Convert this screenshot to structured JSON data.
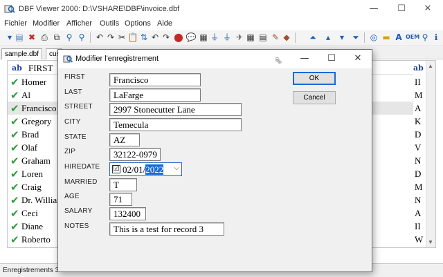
{
  "window": {
    "title": "DBF Viewer 2000: D:\\VSHARE\\DBF\\invoice.dbf",
    "minimize_icon": "minimize-icon",
    "maximize_icon": "maximize-icon",
    "close_icon": "close-icon"
  },
  "menu": [
    "Fichier",
    "Modifier",
    "Afficher",
    "Outils",
    "Options",
    "Aide"
  ],
  "tabs": [
    "sample.dbf",
    "cus"
  ],
  "grid": {
    "header_type": "ab",
    "header_label": "FIRST",
    "right_header_type": "ab",
    "rows": [
      {
        "name": "Homer",
        "right": "II",
        "selected": false
      },
      {
        "name": "Al",
        "right": "M",
        "selected": false
      },
      {
        "name": "Francisco",
        "right": "A",
        "selected": true
      },
      {
        "name": "Gregory",
        "right": "K",
        "selected": false
      },
      {
        "name": "Brad",
        "right": "D",
        "selected": false
      },
      {
        "name": "Olaf",
        "right": "V",
        "selected": false
      },
      {
        "name": "Graham",
        "right": "N",
        "selected": false
      },
      {
        "name": "Loren",
        "right": "D",
        "selected": false
      },
      {
        "name": "Craig",
        "right": "M",
        "selected": false
      },
      {
        "name": "Dr. William",
        "right": "N",
        "selected": false
      },
      {
        "name": "Ceci",
        "right": "A",
        "selected": false
      },
      {
        "name": "Diane",
        "right": "II",
        "selected": false
      },
      {
        "name": "Roberto",
        "right": "W",
        "selected": false
      }
    ]
  },
  "status": {
    "records": "Enregistrements 3/9"
  },
  "dialog": {
    "title": "Modifier l'enregistrement",
    "fields": {
      "first": {
        "label": "FIRST",
        "value": "Francisco"
      },
      "last": {
        "label": "LAST",
        "value": "LaFarge"
      },
      "street": {
        "label": "STREET",
        "value": "2997 Stonecutter Lane"
      },
      "city": {
        "label": "CITY",
        "value": "Temecula"
      },
      "state": {
        "label": "STATE",
        "value": "AZ"
      },
      "zip": {
        "label": "ZIP",
        "value": "32122-0979"
      },
      "hiredate": {
        "label": "HIREDATE",
        "value_prefix": "02/01/",
        "value_year": "2022",
        "checked": "☑"
      },
      "married": {
        "label": "MARRIED",
        "value": "T"
      },
      "age": {
        "label": "AGE",
        "value": "71"
      },
      "salary": {
        "label": "SALARY",
        "value": "132400"
      },
      "notes": {
        "label": "NOTES",
        "value": "This is a test for record 3"
      }
    },
    "ok_label": "OK",
    "cancel_label": "Cancel"
  }
}
